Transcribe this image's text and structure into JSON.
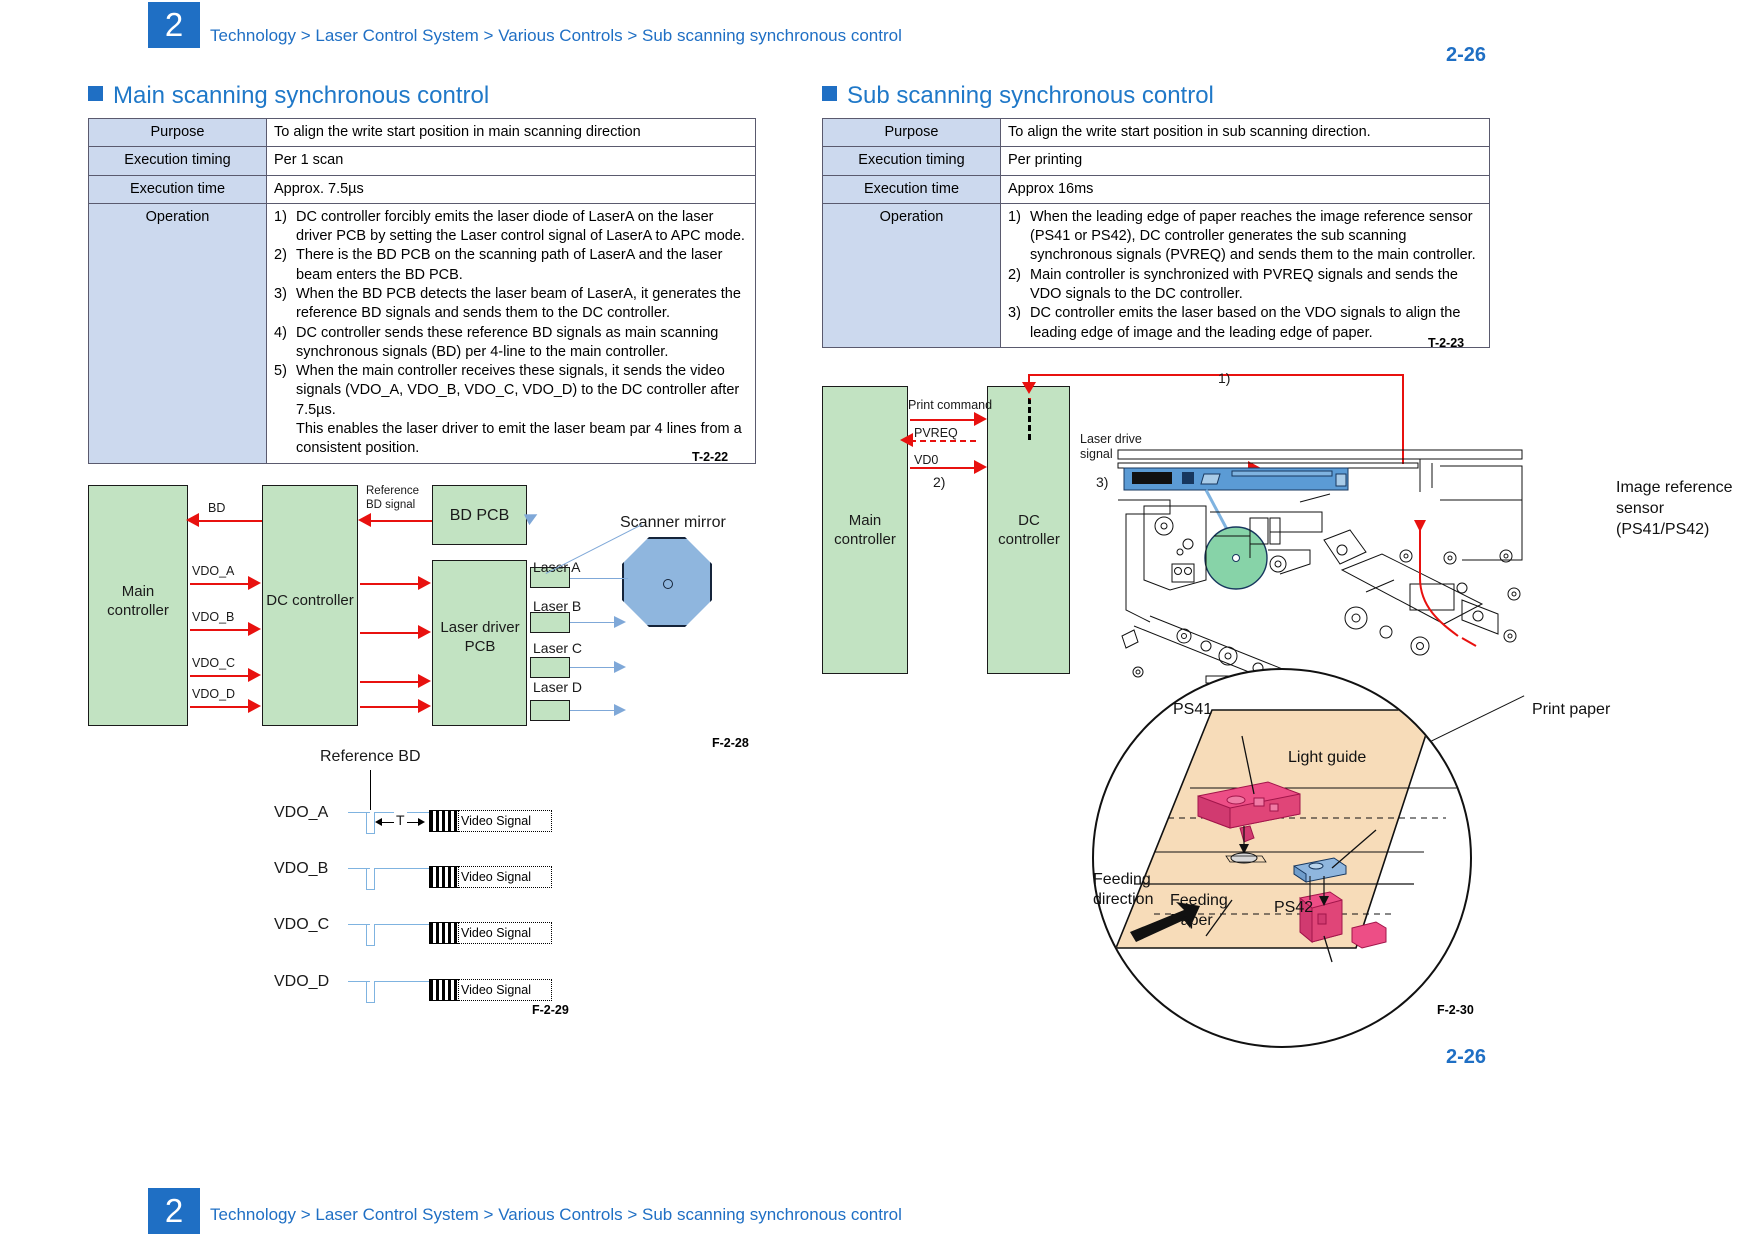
{
  "header": {
    "chapter": "2",
    "breadcrumb": "Technology > Laser Control System > Various Controls > Sub scanning synchronous control",
    "page_number": "2-26"
  },
  "footer": {
    "chapter": "2",
    "breadcrumb": "Technology > Laser Control System > Various Controls > Sub scanning synchronous control",
    "page_number": "2-26"
  },
  "left": {
    "heading": "Main scanning synchronous control",
    "table": {
      "caption": "T-2-22",
      "rows": [
        {
          "key": "Purpose",
          "value": "To align the write start position in main scanning direction"
        },
        {
          "key": "Execution timing",
          "value": "Per 1 scan"
        },
        {
          "key": "Execution time",
          "value": "Approx. 7.5µs"
        }
      ],
      "operation_key": "Operation",
      "operations": [
        {
          "n": "1)",
          "text": "DC controller forcibly emits the laser diode of LaserA on the laser driver PCB by setting the Laser control signal of LaserA to APC mode."
        },
        {
          "n": "2)",
          "text": "There is the BD PCB on the scanning path of LaserA and the laser beam enters the BD PCB."
        },
        {
          "n": "3)",
          "text": "When the BD PCB detects the laser beam of LaserA, it generates the reference BD signals and sends them to the DC controller."
        },
        {
          "n": "4)",
          "text": "DC controller sends these reference BD signals as main scanning synchronous signals (BD) per 4-line to the main controller."
        },
        {
          "n": "5)",
          "text": "When the main controller receives these signals, it sends the video signals (VDO_A, VDO_B, VDO_C, VDO_D) to the DC controller after 7.5µs."
        },
        {
          "n": "",
          "text": "This enables the laser driver to emit the laser beam par 4 lines from a consistent position."
        }
      ]
    },
    "block_diagram": {
      "caption": "F-2-28",
      "blocks": [
        {
          "name": "main-controller",
          "label": "Main\ncontroller"
        },
        {
          "name": "dc-controller",
          "label": "DC controller"
        },
        {
          "name": "bd-pcb",
          "label": "BD PCB"
        },
        {
          "name": "laser-driver-pcb",
          "label": "Laser driver\nPCB"
        }
      ],
      "signals": [
        "BD",
        "VDO_A",
        "VDO_B",
        "VDO_C",
        "VDO_D"
      ],
      "reference_bd_signal": "Reference\nBD signal",
      "lasers": [
        "Laser A",
        "Laser B",
        "Laser C",
        "Laser D"
      ],
      "scanner_mirror": "Scanner mirror"
    },
    "waveform": {
      "caption": "F-2-29",
      "reference_bd": "Reference BD",
      "interval_label": "T",
      "channels": [
        "VDO_A",
        "VDO_B",
        "VDO_C",
        "VDO_D"
      ],
      "video_signal_label": "Video Signal"
    }
  },
  "right": {
    "heading": "Sub scanning synchronous control",
    "table": {
      "caption": "T-2-23",
      "rows": [
        {
          "key": "Purpose",
          "value": "To align the write start position in sub scanning direction."
        },
        {
          "key": "Execution timing",
          "value": "Per printing"
        },
        {
          "key": "Execution time",
          "value": "Approx 16ms"
        }
      ],
      "operation_key": "Operation",
      "operations": [
        {
          "n": "1)",
          "text": "When the leading edge of paper reaches the image reference sensor (PS41 or PS42), DC controller generates the sub scanning synchronous signals (PVREQ) and sends them to the main controller."
        },
        {
          "n": "2)",
          "text": "Main controller is synchronized with PVREQ signals and sends the VDO signals to the DC controller."
        },
        {
          "n": "3)",
          "text": "DC controller emits the laser based on the VDO signals to align the leading edge of image and the leading edge of paper."
        }
      ]
    },
    "diagram": {
      "caption": "F-2-30",
      "blocks": [
        {
          "name": "main-controller",
          "label": "Main\ncontroller"
        },
        {
          "name": "dc-controller",
          "label": "DC\ncontroller"
        }
      ],
      "signals": [
        {
          "name": "print-command",
          "label": "Print command"
        },
        {
          "name": "pvreq",
          "label": "PVREQ"
        },
        {
          "name": "vd0",
          "label": "VD0"
        }
      ],
      "step_markers": [
        "1)",
        "2)",
        "3)"
      ],
      "laser_drive_signal": "Laser drive\nsignal",
      "image_reference_sensor": "Image reference\nsensor\n(PS41/PS42)",
      "print_paper": "Print paper",
      "magnifier": {
        "ps41": "PS41",
        "ps42": "PS42",
        "light_guide": "Light guide",
        "feeding_direction": "Feeding\ndirection",
        "feeding_paper": "Feeding\nPaper"
      }
    }
  },
  "colors": {
    "brand_blue": "#1f6fc4",
    "heading_blue": "#1f78c8",
    "table_key_bg": "#ccd9ee",
    "block_green": "#c2e3c2",
    "arrow_red": "#e8110f",
    "beam_blue": "#7fa8d8",
    "mirror_blue": "#8fb6de",
    "paper_tan": "#f7dcb9",
    "sensor_pink": "#e8447f",
    "guide_blue": "#8fb6de"
  }
}
